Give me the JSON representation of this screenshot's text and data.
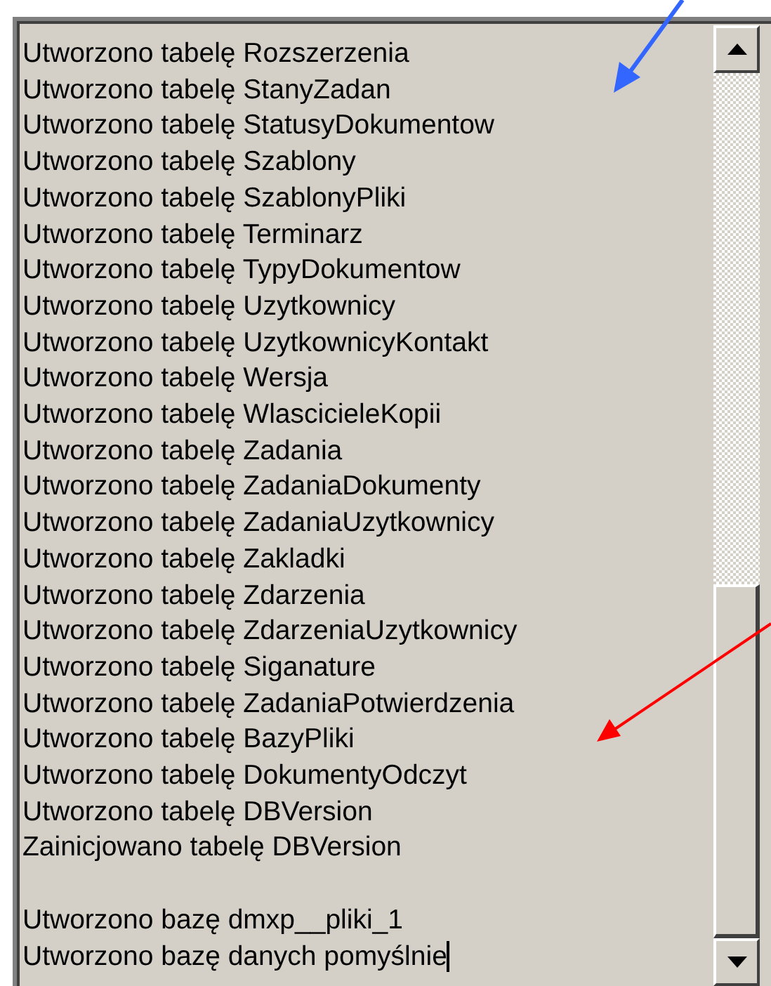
{
  "log": {
    "table_messages": [
      "Utworzono tabelę Rozszerzenia",
      "Utworzono tabelę StanyZadan",
      "Utworzono tabelę StatusyDokumentow",
      "Utworzono tabelę Szablony",
      "Utworzono tabelę SzablonyPliki",
      "Utworzono tabelę Terminarz",
      "Utworzono tabelę TypyDokumentow",
      "Utworzono tabelę Uzytkownicy",
      "Utworzono tabelę UzytkownicyKontakt",
      "Utworzono tabelę Wersja",
      "Utworzono tabelę WlascicieleKopii",
      "Utworzono tabelę Zadania",
      "Utworzono tabelę ZadaniaDokumenty",
      "Utworzono tabelę ZadaniaUzytkownicy",
      "Utworzono tabelę Zakladki",
      "Utworzono tabelę Zdarzenia",
      "Utworzono tabelę ZdarzeniaUzytkownicy",
      "Utworzono tabelę Siganature",
      "Utworzono tabelę ZadaniaPotwierdzenia",
      "Utworzono tabelę BazyPliki",
      "Utworzono tabelę DokumentyOdczyt",
      "Utworzono tabelę DBVersion",
      "Zainicjowano tabelę DBVersion"
    ],
    "database_messages": [
      "Utworzono bazę dmxp__pliki_1",
      "Utworzono bazę danych pomyślnie"
    ],
    "text_cursor_visible": true
  }
}
